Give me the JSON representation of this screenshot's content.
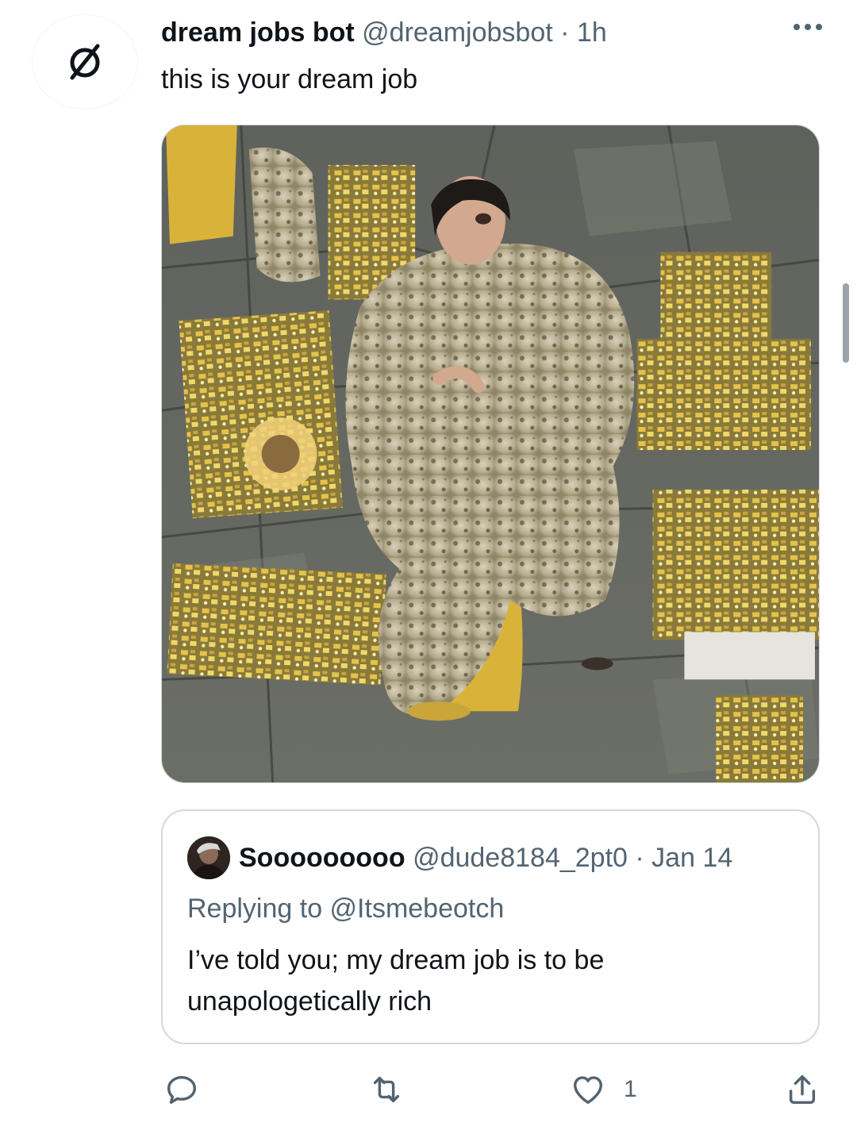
{
  "tweet": {
    "avatar_glyph": "ø",
    "name": "dream jobs bot",
    "handle": "@dreamjobsbot",
    "separator": "·",
    "time": "1h",
    "text": "this is your dream job",
    "more_icon": "more-horizontal-icon"
  },
  "quote": {
    "name": "Sooooooooo",
    "handle": "@dude8184_2pt0",
    "separator": "·",
    "time": "Jan 14",
    "replying_to": "Replying to @Itsmebeotch",
    "text": "I’ve told you; my dream job is to be unapologetically rich"
  },
  "actions": {
    "reply_icon": "reply-icon",
    "retweet_icon": "retweet-icon",
    "like_icon": "heart-icon",
    "like_count": "1",
    "share_icon": "share-icon"
  },
  "colors": {
    "text": "#0f1419",
    "muted": "#536471",
    "border": "#cfd9de"
  }
}
